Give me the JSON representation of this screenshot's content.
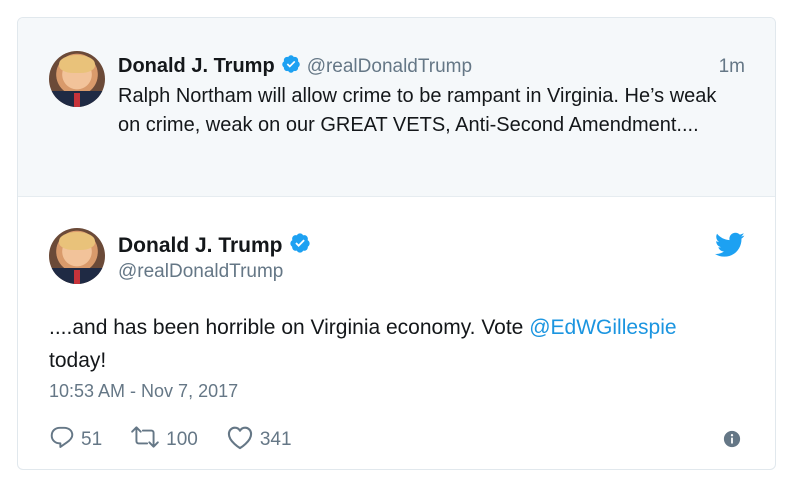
{
  "parent_tweet": {
    "author_name": "Donald J. Trump",
    "handle": "@realDonaldTrump",
    "time": "1m",
    "text": "Ralph Northam will allow crime to be rampant in Virginia. He’s weak on crime, weak on our GREAT VETS, Anti-Second Amendment...."
  },
  "main_tweet": {
    "author_name": "Donald J. Trump",
    "handle": "@realDonaldTrump",
    "text_before": "....and has been horrible on Virginia economy. Vote ",
    "mention": "@EdWGillespie",
    "text_after": " today!",
    "timestamp": "10:53 AM - Nov 7, 2017",
    "replies": "51",
    "retweets": "100",
    "likes": "341"
  },
  "icons": {
    "verified": "verified-badge-icon",
    "twitter_logo": "twitter-bird-icon",
    "reply": "reply-icon",
    "retweet": "retweet-icon",
    "like": "heart-icon",
    "info": "info-icon"
  },
  "colors": {
    "brand_blue": "#1da1f2",
    "link_blue": "#1b95e0",
    "muted_text": "#657786",
    "parent_bg": "#f5f8fa"
  }
}
